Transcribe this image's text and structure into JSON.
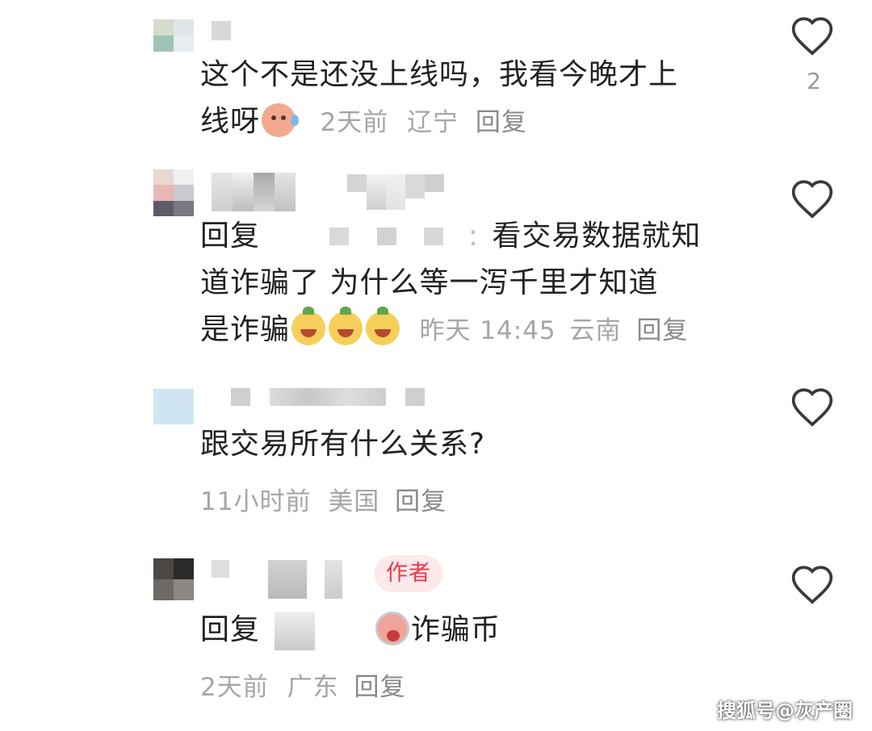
{
  "comments": [
    {
      "text_line1": "这个不是还没上线吗，我看今晚才上",
      "text_line2": "线呀",
      "time": "2天前",
      "location": "辽宁",
      "reply_label": "回复",
      "like_count": "2"
    },
    {
      "reply_prefix": "回复",
      "text_line1_tail": "看交易数据就知",
      "text_line2": "道诈骗了 为什么等一泻千里才知道",
      "text_line3": "是诈骗",
      "time": "昨天 14:45",
      "location": "云南",
      "reply_label": "回复"
    },
    {
      "text_line1": "跟交易所有什么关系?",
      "time": "11小时前",
      "location": "美国",
      "reply_label": "回复"
    },
    {
      "author_badge": "作者",
      "reply_prefix": "回复",
      "text_tail": "诈骗币",
      "time": "2天前",
      "location": "广东",
      "reply_label": "回复"
    }
  ],
  "icons": {
    "like": "heart-outline-icon",
    "emoji_sweat": "sweat-smile-emoji-icon",
    "emoji_grin": "grin-emoji-icon",
    "emoji_cry": "cry-emoji-icon"
  },
  "colors": {
    "author_badge_text": "#e63a4c",
    "author_badge_bg": "#fde8ea",
    "meta_text": "#a6a6a6"
  },
  "watermark": "搜狐号@灰产圈"
}
